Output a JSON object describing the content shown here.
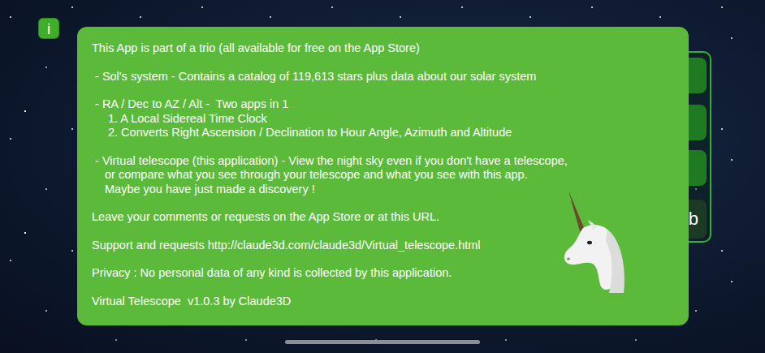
{
  "info_button": {
    "label": "i"
  },
  "keypad": {
    "visible_key": "b"
  },
  "dialog": {
    "paragraphs": [
      [
        {
          "text": "This App is part of a trio (all available for free on the App Store)",
          "kind": "plain"
        }
      ],
      [
        {
          "text": " - Sol's system - Contains a catalog of 119,613 stars plus data about our solar system",
          "kind": "plain"
        }
      ],
      [
        {
          "text": " - RA / Dec to AZ / Alt -  Two apps in 1",
          "kind": "plain"
        },
        {
          "text": "1. A Local Sidereal Time Clock",
          "kind": "sub"
        },
        {
          "text": "2. Converts Right Ascension / Declination to Hour Angle, Azimuth and Altitude",
          "kind": "sub"
        }
      ],
      [
        {
          "text": " - Virtual telescope (this application) - View the night sky even if you don't have a telescope,",
          "kind": "plain"
        },
        {
          "text": "or compare what you see through your telescope and what you see with this app.",
          "kind": "cont"
        },
        {
          "text": "Maybe you have just made a discovery !",
          "kind": "cont"
        }
      ],
      [
        {
          "text": "Leave your comments or requests on the App Store or at this URL.",
          "kind": "plain"
        }
      ],
      [
        {
          "text": "Support and requests http://claude3d.com/claude3d/Virtual_telescope.html",
          "kind": "plain"
        }
      ],
      [
        {
          "text": "Privacy : No personal data of any kind is collected by this application.",
          "kind": "plain"
        }
      ],
      [
        {
          "text": "Virtual Telescope  v1.0.3 by Claude3D",
          "kind": "plain"
        }
      ]
    ]
  }
}
